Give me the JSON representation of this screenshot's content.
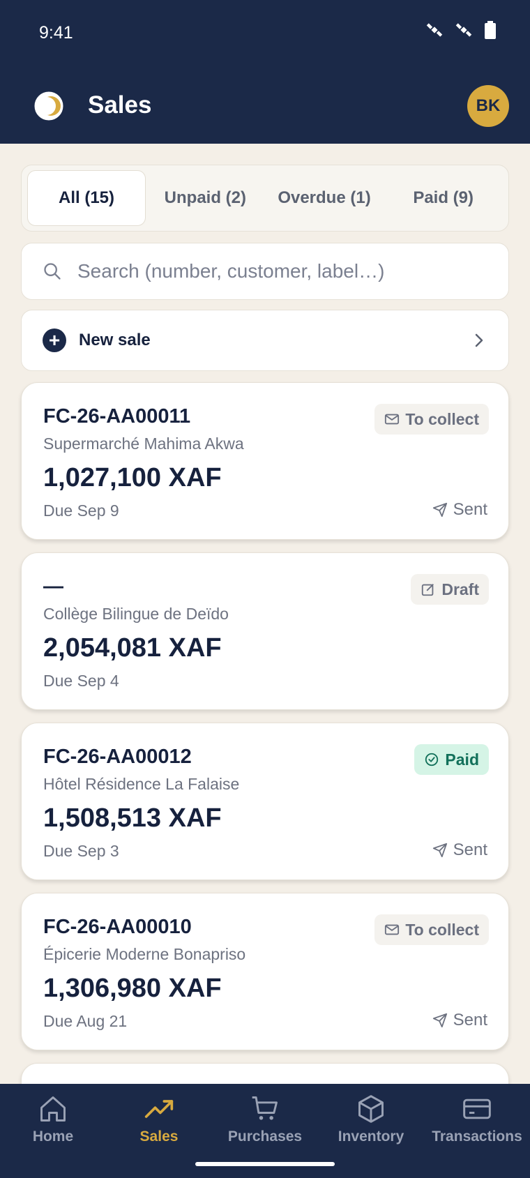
{
  "status": {
    "time": "9:41"
  },
  "header": {
    "title": "Sales",
    "avatar_initials": "BK"
  },
  "tabs": [
    {
      "label": "All (15)",
      "active": true
    },
    {
      "label": "Unpaid (2)",
      "active": false
    },
    {
      "label": "Overdue (1)",
      "active": false
    },
    {
      "label": "Paid (9)",
      "active": false
    }
  ],
  "search": {
    "placeholder": "Search (number, customer, label…)"
  },
  "new_sale": {
    "label": "New sale"
  },
  "invoices": [
    {
      "number": "FC-26-AA00011",
      "customer": "Supermarché Mahima Akwa",
      "amount": "1,027,100 XAF",
      "due": "Due Sep 9",
      "status": "To collect",
      "status_icon": "mail-icon",
      "sent": "Sent"
    },
    {
      "number": "—",
      "customer": "Collège Bilingue de Deïdo",
      "amount": "2,054,081 XAF",
      "due": "Due Sep 4",
      "status": "Draft",
      "status_icon": "edit-icon",
      "sent": ""
    },
    {
      "number": "FC-26-AA00012",
      "customer": "Hôtel Résidence La Falaise",
      "amount": "1,508,513 XAF",
      "due": "Due Sep 3",
      "status": "Paid",
      "status_icon": "check-circle-icon",
      "sent": "Sent"
    },
    {
      "number": "FC-26-AA00010",
      "customer": "Épicerie Moderne Bonapriso",
      "amount": "1,306,980 XAF",
      "due": "Due Aug 21",
      "status": "To collect",
      "status_icon": "mail-icon",
      "sent": "Sent"
    }
  ],
  "nav": [
    {
      "label": "Home",
      "icon": "home-icon"
    },
    {
      "label": "Sales",
      "icon": "trending-up-icon",
      "active": true
    },
    {
      "label": "Purchases",
      "icon": "cart-icon"
    },
    {
      "label": "Inventory",
      "icon": "box-icon"
    },
    {
      "label": "Transactions",
      "icon": "card-icon"
    }
  ],
  "colors": {
    "primary": "#1b2948",
    "accent": "#d8aa3f",
    "background": "#f4efe7",
    "paid_bg": "#d5f4e6",
    "paid_text": "#12705a"
  }
}
